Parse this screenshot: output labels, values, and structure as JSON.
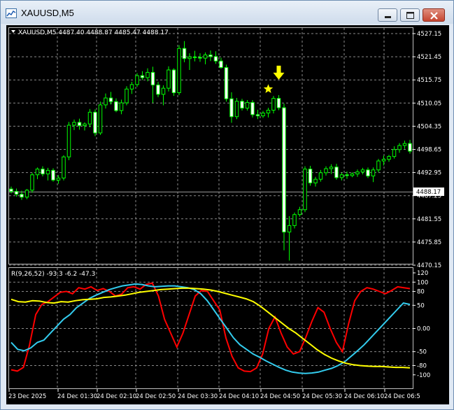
{
  "window": {
    "title": "XAUUSD,M5",
    "icons": [
      "chart-app-icon",
      "minimize-icon",
      "maximize-icon",
      "close-icon"
    ]
  },
  "main_chart": {
    "header": "XAUUSD,M5  4487.40 4488.87 4485.47 4488.17",
    "current_price_label": "4488.17",
    "current_price": 4488.17,
    "price_ticks": [
      "4527.15",
      "4521.45",
      "4515.75",
      "4510.05",
      "4504.35",
      "4498.65",
      "4492.95",
      "4487.25",
      "4481.55",
      "4475.85",
      "4470.15"
    ],
    "price_tick_values": [
      4527.15,
      4521.45,
      4515.75,
      4510.05,
      4504.35,
      4498.65,
      4492.95,
      4487.25,
      4481.55,
      4475.85,
      4470.15
    ],
    "bull_color": "#00ff00",
    "bear_color": "#ffffff",
    "arrow_color": "#ffff00"
  },
  "indicator": {
    "header": "R(9,26,52) -93.3 -6.2 -47.3",
    "ticks": [
      "120",
      "100",
      "80",
      "50",
      "0.00",
      "-50",
      "-80",
      "-100"
    ],
    "tick_values": [
      120,
      100,
      80,
      50,
      0,
      -50,
      -80,
      -100
    ],
    "colors": {
      "fast": "#ff0000",
      "mid": "#33ccee",
      "slow": "#ffff00"
    }
  },
  "time_axis": [
    "23 Dec 2025",
    "24 Dec 01:30",
    "24 Dec 02:10",
    "24 Dec 02:50",
    "24 Dec 03:30",
    "24 Dec 04:10",
    "24 Dec 04:50",
    "24 Dec 05:30",
    "24 Dec 06:10",
    "24 Dec 06:5"
  ],
  "chart_data": {
    "type": "candlestick",
    "symbol": "XAUUSD",
    "timeframe": "M5",
    "ylim": [
      4470.15,
      4527.15
    ],
    "ohlc": [
      [
        4488.9,
        4489.5,
        4487.8,
        4488.3
      ],
      [
        4488.3,
        4489.0,
        4487.0,
        4487.6
      ],
      [
        4487.6,
        4488.5,
        4486.2,
        4486.9
      ],
      [
        4486.9,
        4488.9,
        4486.4,
        4488.6
      ],
      [
        4488.6,
        4492.9,
        4488.0,
        4492.4
      ],
      [
        4492.4,
        4494.2,
        4491.3,
        4493.8
      ],
      [
        4493.8,
        4494.5,
        4492.0,
        4492.6
      ],
      [
        4492.6,
        4494.1,
        4491.0,
        4493.5
      ],
      [
        4493.5,
        4494.0,
        4490.7,
        4491.1
      ],
      [
        4491.1,
        4492.3,
        4490.2,
        4491.6
      ],
      [
        4491.6,
        4497.2,
        4491.0,
        4496.8
      ],
      [
        4496.8,
        4505.4,
        4496.0,
        4504.6
      ],
      [
        4504.6,
        4506.0,
        4503.4,
        4505.3
      ],
      [
        4505.3,
        4506.2,
        4503.5,
        4504.5
      ],
      [
        4504.5,
        4505.3,
        4503.3,
        4504.9
      ],
      [
        4504.9,
        4508.6,
        4504.1,
        4507.8
      ],
      [
        4507.8,
        4508.5,
        4501.9,
        4502.7
      ],
      [
        4502.7,
        4510.4,
        4502.2,
        4509.6
      ],
      [
        4509.6,
        4512.4,
        4508.7,
        4511.3
      ],
      [
        4511.3,
        4512.8,
        4509.7,
        4510.4
      ],
      [
        4510.4,
        4511.2,
        4507.8,
        4508.2
      ],
      [
        4508.2,
        4510.9,
        4507.3,
        4510.1
      ],
      [
        4510.1,
        4514.2,
        4509.5,
        4513.5
      ],
      [
        4513.5,
        4515.3,
        4512.3,
        4514.6
      ],
      [
        4514.6,
        4517.4,
        4514.0,
        4516.8
      ],
      [
        4516.8,
        4517.9,
        4515.7,
        4516.3
      ],
      [
        4516.3,
        4518.6,
        4515.4,
        4517.6
      ],
      [
        4517.6,
        4519.0,
        4510.1,
        4514.5
      ],
      [
        4514.5,
        4515.3,
        4511.5,
        4512.2
      ],
      [
        4512.2,
        4514.4,
        4509.5,
        4513.7
      ],
      [
        4513.7,
        4519.1,
        4512.9,
        4518.2
      ],
      [
        4518.2,
        4518.6,
        4511.8,
        4512.6
      ],
      [
        4512.6,
        4524.3,
        4512.0,
        4523.5
      ],
      [
        4523.5,
        4525.3,
        4520.1,
        4521.0
      ],
      [
        4521.0,
        4522.3,
        4518.2,
        4521.4
      ],
      [
        4521.4,
        4522.9,
        4520.3,
        4521.3
      ],
      [
        4521.3,
        4522.3,
        4520.2,
        4521.1
      ],
      [
        4521.1,
        4522.5,
        4519.6,
        4521.9
      ],
      [
        4521.9,
        4523.0,
        4520.4,
        4521.5
      ],
      [
        4521.5,
        4522.8,
        4519.7,
        4520.4
      ],
      [
        4520.4,
        4521.2,
        4518.5,
        4518.8
      ],
      [
        4518.8,
        4519.5,
        4510.4,
        4511.1
      ],
      [
        4511.1,
        4512.7,
        4505.2,
        4506.7
      ],
      [
        4506.7,
        4511.3,
        4506.1,
        4510.5
      ],
      [
        4510.5,
        4511.1,
        4508.2,
        4508.8
      ],
      [
        4508.8,
        4510.8,
        4508.2,
        4510.2
      ],
      [
        4510.2,
        4510.8,
        4506.5,
        4507.2
      ],
      [
        4507.2,
        4508.4,
        4506.1,
        4506.9
      ],
      [
        4506.9,
        4508.1,
        4506.4,
        4507.6
      ],
      [
        4507.6,
        4508.9,
        4506.5,
        4508.3
      ],
      [
        4508.3,
        4511.8,
        4507.5,
        4511.2
      ],
      [
        4511.2,
        4512.0,
        4508.3,
        4508.9
      ],
      [
        4508.9,
        4509.9,
        4473.8,
        4478.3
      ],
      [
        4478.3,
        4482.2,
        4471.3,
        4479.9
      ],
      [
        4479.9,
        4483.1,
        4479.2,
        4482.6
      ],
      [
        4482.6,
        4484.5,
        4482.1,
        4483.8
      ],
      [
        4483.8,
        4494.5,
        4483.2,
        4493.8
      ],
      [
        4493.8,
        4494.6,
        4489.7,
        4490.4
      ],
      [
        4490.4,
        4491.9,
        4489.5,
        4491.3
      ],
      [
        4491.3,
        4493.6,
        4490.7,
        4492.9
      ],
      [
        4492.9,
        4494.5,
        4492.2,
        4493.9
      ],
      [
        4493.9,
        4495.0,
        4492.6,
        4494.3
      ],
      [
        4494.3,
        4495.1,
        4491.2,
        4491.7
      ],
      [
        4491.7,
        4492.9,
        4491.0,
        4492.4
      ],
      [
        4492.4,
        4493.2,
        4491.4,
        4492.2
      ],
      [
        4492.2,
        4493.0,
        4491.8,
        4492.6
      ],
      [
        4492.6,
        4493.7,
        4491.9,
        4493.1
      ],
      [
        4493.1,
        4494.1,
        4492.5,
        4493.6
      ],
      [
        4493.6,
        4494.2,
        4491.6,
        4492.1
      ],
      [
        4492.1,
        4494.2,
        4490.6,
        4493.6
      ],
      [
        4493.6,
        4496.3,
        4493.0,
        4495.8
      ],
      [
        4495.8,
        4497.1,
        4494.7,
        4496.2
      ],
      [
        4496.2,
        4497.3,
        4495.6,
        4496.9
      ],
      [
        4496.9,
        4499.4,
        4496.4,
        4498.6
      ],
      [
        4498.6,
        4500.2,
        4497.8,
        4499.6
      ],
      [
        4499.6,
        4500.8,
        4498.8,
        4500.1
      ],
      [
        4500.1,
        4501.0,
        4497.6,
        4498.2
      ]
    ],
    "markers": [
      {
        "type": "star",
        "bar": 49,
        "price": 4513.5
      },
      {
        "type": "arrow-down",
        "bar": 51,
        "price": 4516.5
      }
    ],
    "indicator": {
      "name": "R(9,26,52)",
      "last_values": [
        -93.3,
        -6.2,
        -47.3
      ],
      "ylim": [
        -120,
        120
      ],
      "series": [
        {
          "name": "fast",
          "values": [
            -89,
            -92,
            -84,
            -35,
            30,
            52,
            58,
            68,
            78,
            80,
            75,
            88,
            85,
            90,
            82,
            86,
            80,
            70,
            74,
            88,
            90,
            85,
            95,
            98,
            70,
            20,
            -10,
            -40,
            -10,
            30,
            70,
            82,
            80,
            60,
            40,
            -20,
            -60,
            -85,
            -92,
            -93,
            -85,
            -55,
            0,
            25,
            -10,
            -40,
            -55,
            -50,
            -20,
            15,
            45,
            35,
            0,
            -30,
            -50,
            10,
            60,
            80,
            88,
            85,
            80,
            75,
            82,
            90,
            88,
            86
          ]
        },
        {
          "name": "mid",
          "values": [
            -30,
            -45,
            -48,
            -42,
            -30,
            -25,
            -10,
            5,
            20,
            30,
            45,
            55,
            65,
            72,
            78,
            84,
            88,
            92,
            94,
            96,
            95,
            92,
            90,
            91,
            92,
            92,
            90,
            88,
            84,
            75,
            60,
            40,
            20,
            0,
            -20,
            -35,
            -45,
            -55,
            -62,
            -70,
            -77,
            -84,
            -90,
            -94,
            -96,
            -97,
            -96,
            -94,
            -90,
            -86,
            -80,
            -72,
            -60,
            -48,
            -35,
            -20,
            -5,
            10,
            25,
            40,
            55,
            52
          ]
        },
        {
          "name": "slow",
          "values": [
            63,
            58,
            57,
            60,
            59,
            56,
            55,
            58,
            57,
            60,
            62,
            63,
            64,
            67,
            68,
            70,
            72,
            75,
            78,
            80,
            82,
            84,
            85,
            86,
            87,
            87,
            86,
            85,
            83,
            80,
            76,
            72,
            68,
            64,
            58,
            48,
            36,
            24,
            12,
            0,
            -10,
            -22,
            -34,
            -46,
            -56,
            -64,
            -70,
            -75,
            -78,
            -80,
            -81,
            -82,
            -82,
            -83,
            -84,
            -84,
            -85
          ]
        }
      ]
    }
  }
}
